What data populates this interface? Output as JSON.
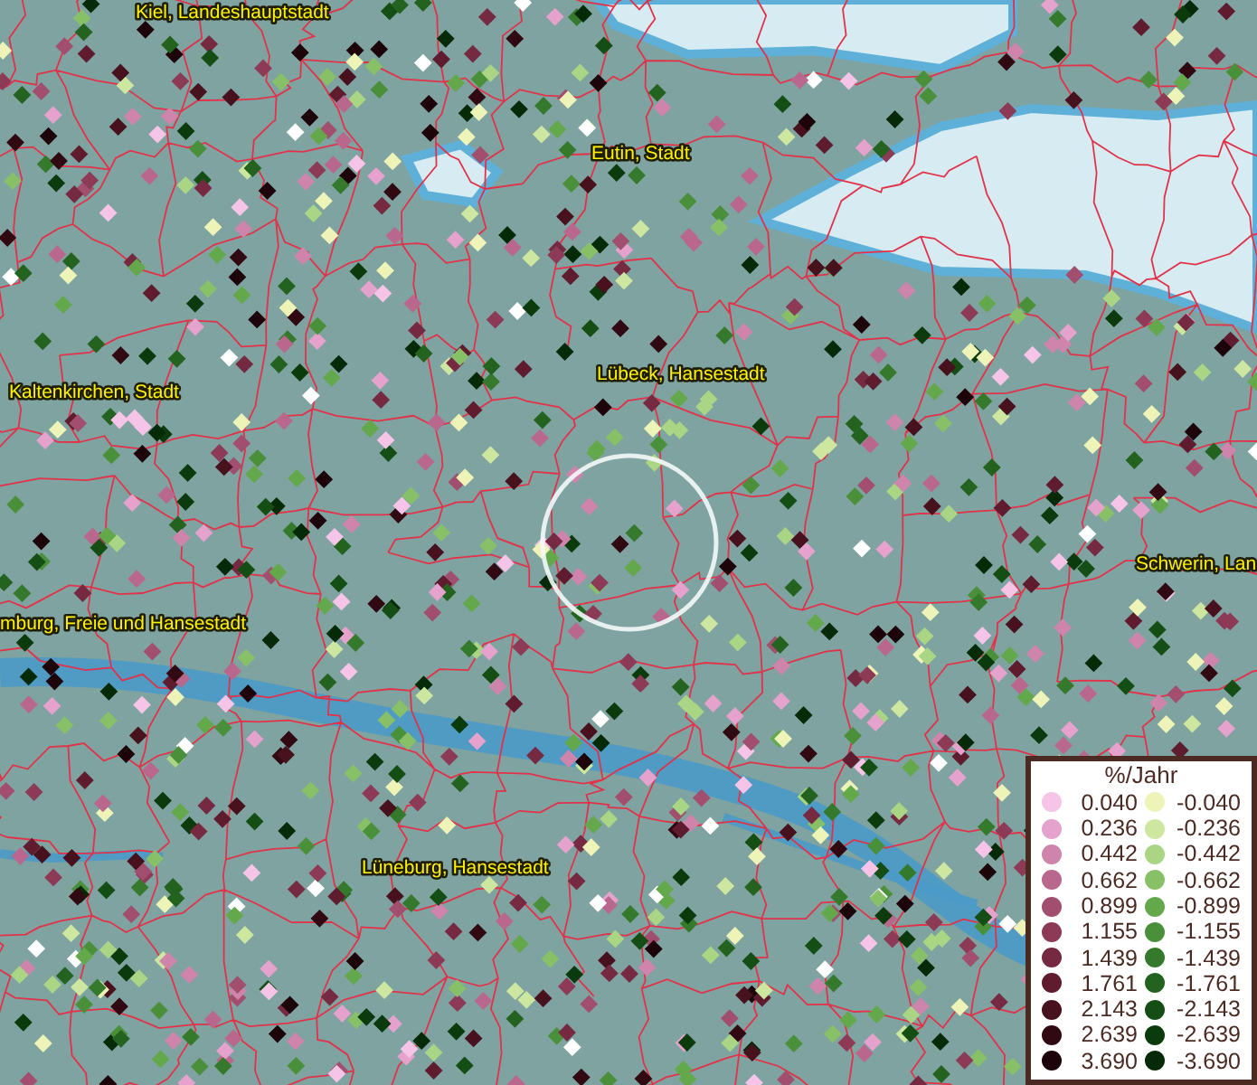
{
  "map": {
    "places": [
      {
        "label": "Kiel, Landeshauptstadt",
        "kind": "city"
      },
      {
        "label": "Eutin, Stadt",
        "kind": "city"
      },
      {
        "label": "Kaltenkirchen, Stadt",
        "kind": "city"
      },
      {
        "label": "Lübeck, Hansestadt",
        "kind": "city"
      },
      {
        "label": "mburg, Freie und Hansestadt",
        "kind": "city"
      },
      {
        "label": "Schwerin, Lan",
        "kind": "city"
      },
      {
        "label": "Lüneburg, Hansestadt",
        "kind": "city"
      }
    ]
  },
  "legend": {
    "title": "%/Jahr",
    "columns": [
      {
        "items": [
          {
            "label": "0.040",
            "color": "#f6c4e6"
          },
          {
            "label": "0.236",
            "color": "#e4a2cc"
          },
          {
            "label": "0.442",
            "color": "#cf84ac"
          },
          {
            "label": "0.662",
            "color": "#b9678c"
          },
          {
            "label": "0.899",
            "color": "#a24e6e"
          },
          {
            "label": "1.155",
            "color": "#8c3a56"
          },
          {
            "label": "1.439",
            "color": "#752a42"
          },
          {
            "label": "1.761",
            "color": "#5e1c2e"
          },
          {
            "label": "2.143",
            "color": "#47111e"
          },
          {
            "label": "2.639",
            "color": "#310912"
          },
          {
            "label": "3.690",
            "color": "#1c040a"
          }
        ]
      },
      {
        "items": [
          {
            "label": "-0.040",
            "color": "#eef4b8"
          },
          {
            "label": "-0.236",
            "color": "#cde6a0"
          },
          {
            "label": "-0.442",
            "color": "#a9d584"
          },
          {
            "label": "-0.662",
            "color": "#88c068"
          },
          {
            "label": "-0.899",
            "color": "#64a84c"
          },
          {
            "label": "-1.155",
            "color": "#4a903a"
          },
          {
            "label": "-1.439",
            "color": "#357a2c"
          },
          {
            "label": "-1.761",
            "color": "#24631f"
          },
          {
            "label": "-2.143",
            "color": "#154e15"
          },
          {
            "label": "-2.639",
            "color": "#0b3a0d"
          },
          {
            "label": "-3.690",
            "color": "#052a07"
          }
        ]
      }
    ]
  }
}
